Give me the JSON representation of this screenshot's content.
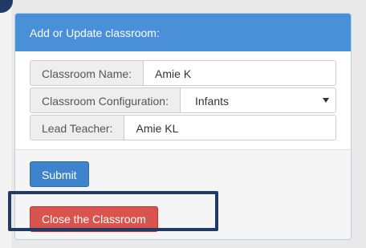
{
  "panel": {
    "heading": "Add or Update classroom:"
  },
  "form": {
    "classroom_name": {
      "label": "Classroom Name:",
      "value": "Amie K"
    },
    "classroom_configuration": {
      "label": "Classroom Configuration:",
      "selected": "Infants"
    },
    "lead_teacher": {
      "label": "Lead Teacher:",
      "value": "Amie KL"
    }
  },
  "buttons": {
    "submit": "Submit",
    "close_classroom": "Close the Classroom"
  },
  "colors": {
    "heading_bg": "#4a90d9",
    "primary": "#3d84cd",
    "danger": "#d9534f",
    "highlight": "#1f3b63"
  }
}
